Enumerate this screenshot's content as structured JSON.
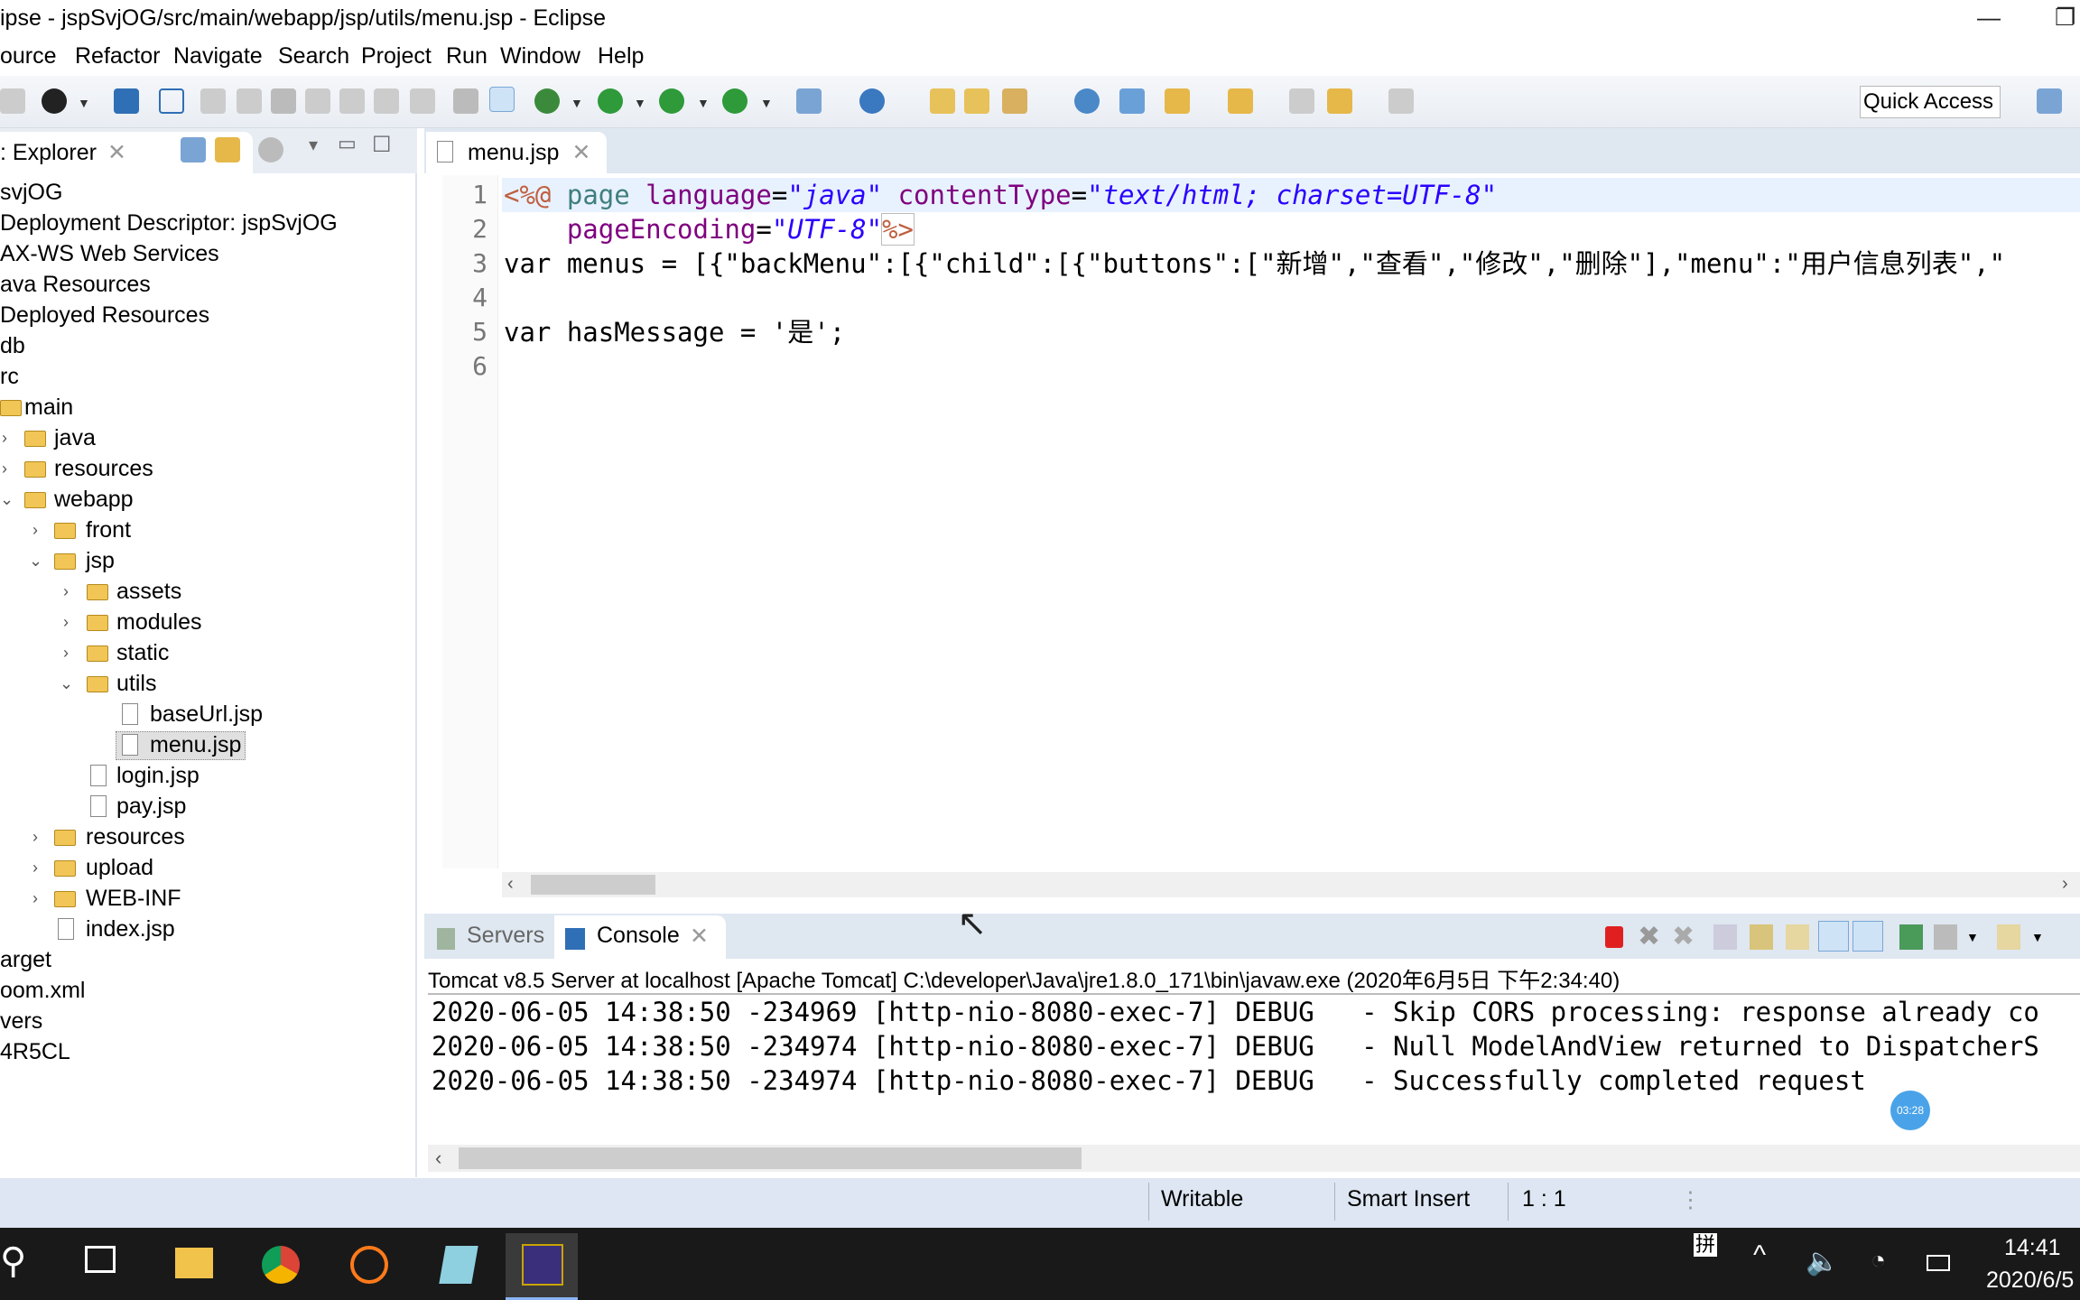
{
  "window": {
    "title": "ipse - jspSvjOG/src/main/webapp/jsp/utils/menu.jsp - Eclipse"
  },
  "menu": [
    "Source",
    "Refactor",
    "Navigate",
    "Search",
    "Project",
    "Run",
    "Window",
    "Help"
  ],
  "menu_visible": [
    "ource",
    "Refactor",
    "Navigate",
    "Search",
    "Project",
    "Run",
    "Window",
    "Help"
  ],
  "toolbar": {
    "quick_access": "Quick Access"
  },
  "explorer": {
    "tab_label": ": Explorer",
    "items": [
      "svjOG",
      "Deployment Descriptor: jspSvjOG",
      "AX-WS Web Services",
      "ava Resources",
      "Deployed Resources",
      "db",
      "rc",
      "main",
      "java",
      "resources",
      "webapp",
      "front",
      "jsp",
      "assets",
      "modules",
      "static",
      "utils",
      "baseUrl.jsp",
      "menu.jsp",
      "login.jsp",
      "pay.jsp",
      "resources",
      "upload",
      "WEB-INF",
      "index.jsp",
      "arget",
      "oom.xml",
      "vers",
      "4R5CL"
    ]
  },
  "editor": {
    "tab_label": "menu.jsp",
    "line_numbers": [
      "1",
      "2",
      "3",
      "4",
      "5",
      "6"
    ],
    "line1": {
      "open": "<%@",
      "page": "page",
      "a1": "language",
      "eq1": "=",
      "v1": "\"java\"",
      "a2": "contentType",
      "eq2": "=",
      "v2": "\"text/html; charset=UTF-8\""
    },
    "line2": {
      "a3": "pageEncoding",
      "eq3": "=",
      "v3": "\"UTF-8\"",
      "close": "%>"
    },
    "line3": "var menus = [{\"backMenu\":[{\"child\":[{\"buttons\":[\"新增\",\"查看\",\"修改\",\"删除\"],\"menu\":\"用户信息列表\",\"",
    "line5": "var hasMessage = '是';"
  },
  "bottom": {
    "tabs": [
      "Servers",
      "Console"
    ],
    "console_header": "Tomcat v8.5 Server at localhost [Apache Tomcat] C:\\developer\\Java\\jre1.8.0_171\\bin\\javaw.exe (2020年6月5日 下午2:34:40)",
    "lines": [
      "2020-06-05 14:38:50 -234969 [http-nio-8080-exec-7] DEBUG   - Skip CORS processing: response already co",
      "2020-06-05 14:38:50 -234974 [http-nio-8080-exec-7] DEBUG   - Null ModelAndView returned to DispatcherS",
      "2020-06-05 14:38:50 -234974 [http-nio-8080-exec-7] DEBUG   - Successfully completed request"
    ],
    "timer_badge": "03:28"
  },
  "status": {
    "writable": "Writable",
    "insert_mode": "Smart Insert",
    "position": "1 : 1"
  },
  "taskbar": {
    "ime": "拼",
    "time": "14:41",
    "date": "2020/6/5"
  },
  "colors": {
    "directive": "#bf5f3f",
    "keyword": "#3f7f7f",
    "attribute": "#7f007f",
    "string": "#2a00ff",
    "current_line": "#e8f2fe",
    "taskbar": "#191919"
  }
}
